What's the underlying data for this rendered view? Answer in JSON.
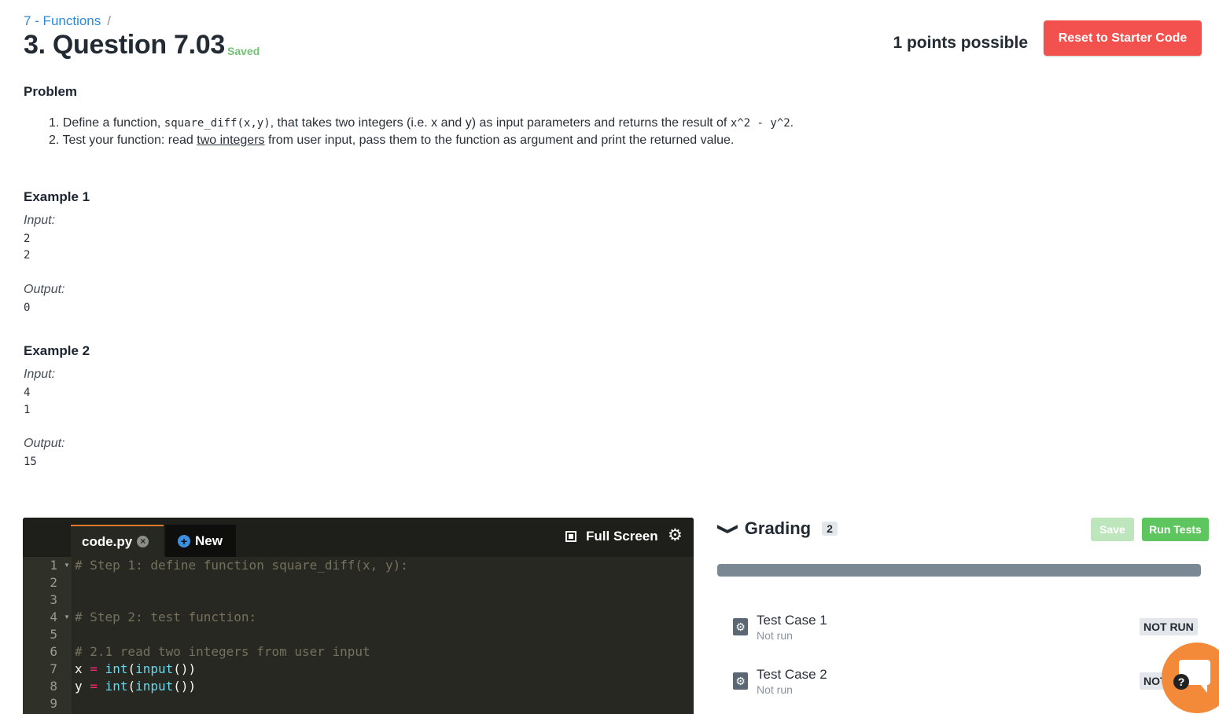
{
  "breadcrumb": {
    "module": "7 - Functions",
    "separator": "/"
  },
  "question": {
    "title": "3. Question 7.03",
    "saved": "Saved",
    "points": "1 points possible",
    "reset_label": "Reset to Starter Code"
  },
  "problem": {
    "heading": "Problem",
    "item1": {
      "num": "1.",
      "t1": "Define a function, ",
      "code1": "square_diff(x,y)",
      "t2": ", that takes two integers (i.e. x and y) as input parameters and returns the result of ",
      "code2": "x^2 - y^2",
      "t3": "."
    },
    "item2": {
      "num": "2.",
      "t1": "Test your function: read ",
      "u": "two integers",
      "t2": " from user input, pass them to the function as argument and print the returned value."
    }
  },
  "examples": [
    {
      "title": "Example 1",
      "input_label": "Input:",
      "inputs": [
        "2",
        "2"
      ],
      "output_label": "Output:",
      "output": "0"
    },
    {
      "title": "Example 2",
      "input_label": "Input:",
      "inputs": [
        "4",
        "1"
      ],
      "output_label": "Output:",
      "output": "15"
    }
  ],
  "editor": {
    "file_tab": "code.py",
    "close_glyph": "×",
    "new_tab": "New",
    "new_glyph": "+",
    "fullscreen_label": "Full Screen",
    "gear_glyph": "⚙",
    "fold_glyph": "▼",
    "line_numbers": [
      "1",
      "2",
      "3",
      "4",
      "5",
      "6",
      "7",
      "8",
      "9"
    ],
    "code": {
      "l1": "# Step 1: define function square_diff(x, y):",
      "l4": "# Step 2: test function:",
      "l6": "# 2.1 read two integers from user input",
      "l7": {
        "var": "x",
        "op": "=",
        "fn1": "int",
        "p1": "(",
        "fn2": "input",
        "p2": "())"
      },
      "l8": {
        "var": "y",
        "op": "=",
        "fn1": "int",
        "p1": "(",
        "fn2": "input",
        "p2": "())"
      }
    }
  },
  "grading": {
    "chevron": "❯",
    "title": "Grading",
    "count": "2",
    "save_label": "Save",
    "run_label": "Run Tests",
    "progress_fraction": 0,
    "icon_glyph": "⚙",
    "test_cases": [
      {
        "name": "Test Case 1",
        "status": "Not run",
        "badge": "NOT RUN"
      },
      {
        "name": "Test Case 2",
        "status": "Not run",
        "badge": "NOT RUN"
      }
    ]
  },
  "chat": {
    "glyph": "?"
  },
  "colors": {
    "accent_blue": "#2f8ad8",
    "danger": "#f2514d",
    "success": "#5fc55f",
    "saved": "#72c174",
    "editor_bg": "#272822"
  }
}
